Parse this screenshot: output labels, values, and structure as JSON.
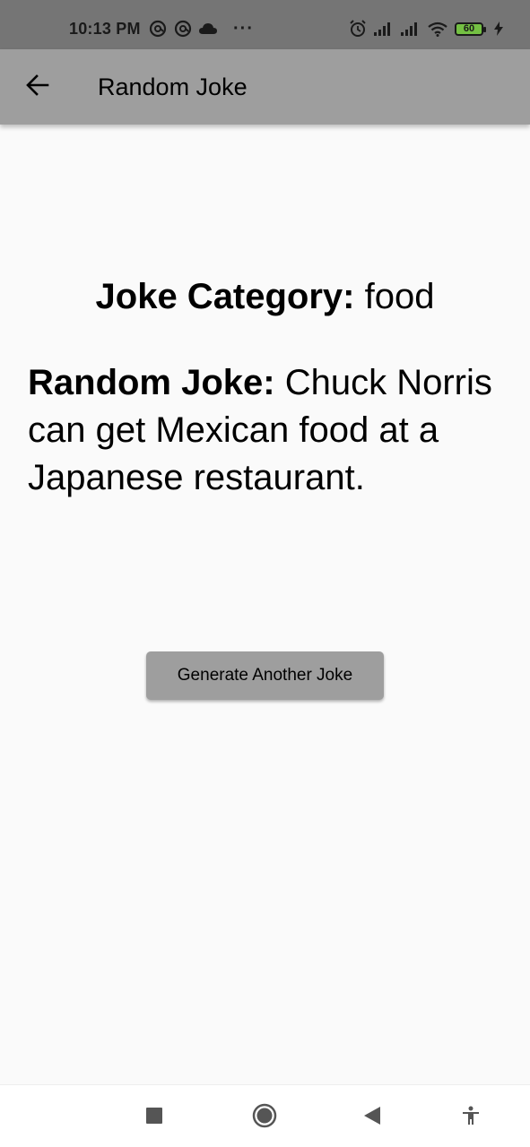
{
  "status_bar": {
    "time": "10:13 PM",
    "dots": "···",
    "battery_level": "60",
    "icons_left": [
      "at-sign-icon",
      "at-sign-icon",
      "cloud-icon"
    ],
    "icons_right": [
      "alarm-icon",
      "signal-icon",
      "signal-icon",
      "wifi-icon",
      "battery-icon",
      "charging-icon"
    ]
  },
  "app_bar": {
    "title": "Random Joke",
    "back_icon": "arrow-left-icon"
  },
  "content": {
    "category_label": "Joke Category:",
    "category_value": "food",
    "joke_label": "Random Joke:",
    "joke_text": "Chuck Norris can get Mexican food at a Japanese restaurant."
  },
  "actions": {
    "generate_label": "Generate Another Joke"
  },
  "nav_bar": {
    "icons": [
      "recents-icon",
      "home-icon",
      "back-icon",
      "accessibility-icon"
    ]
  },
  "colors": {
    "status_bar": "#757575",
    "app_bar": "#9e9e9e",
    "background": "#fafafa",
    "button": "#9e9e9e",
    "battery_fill": "#74c043"
  }
}
